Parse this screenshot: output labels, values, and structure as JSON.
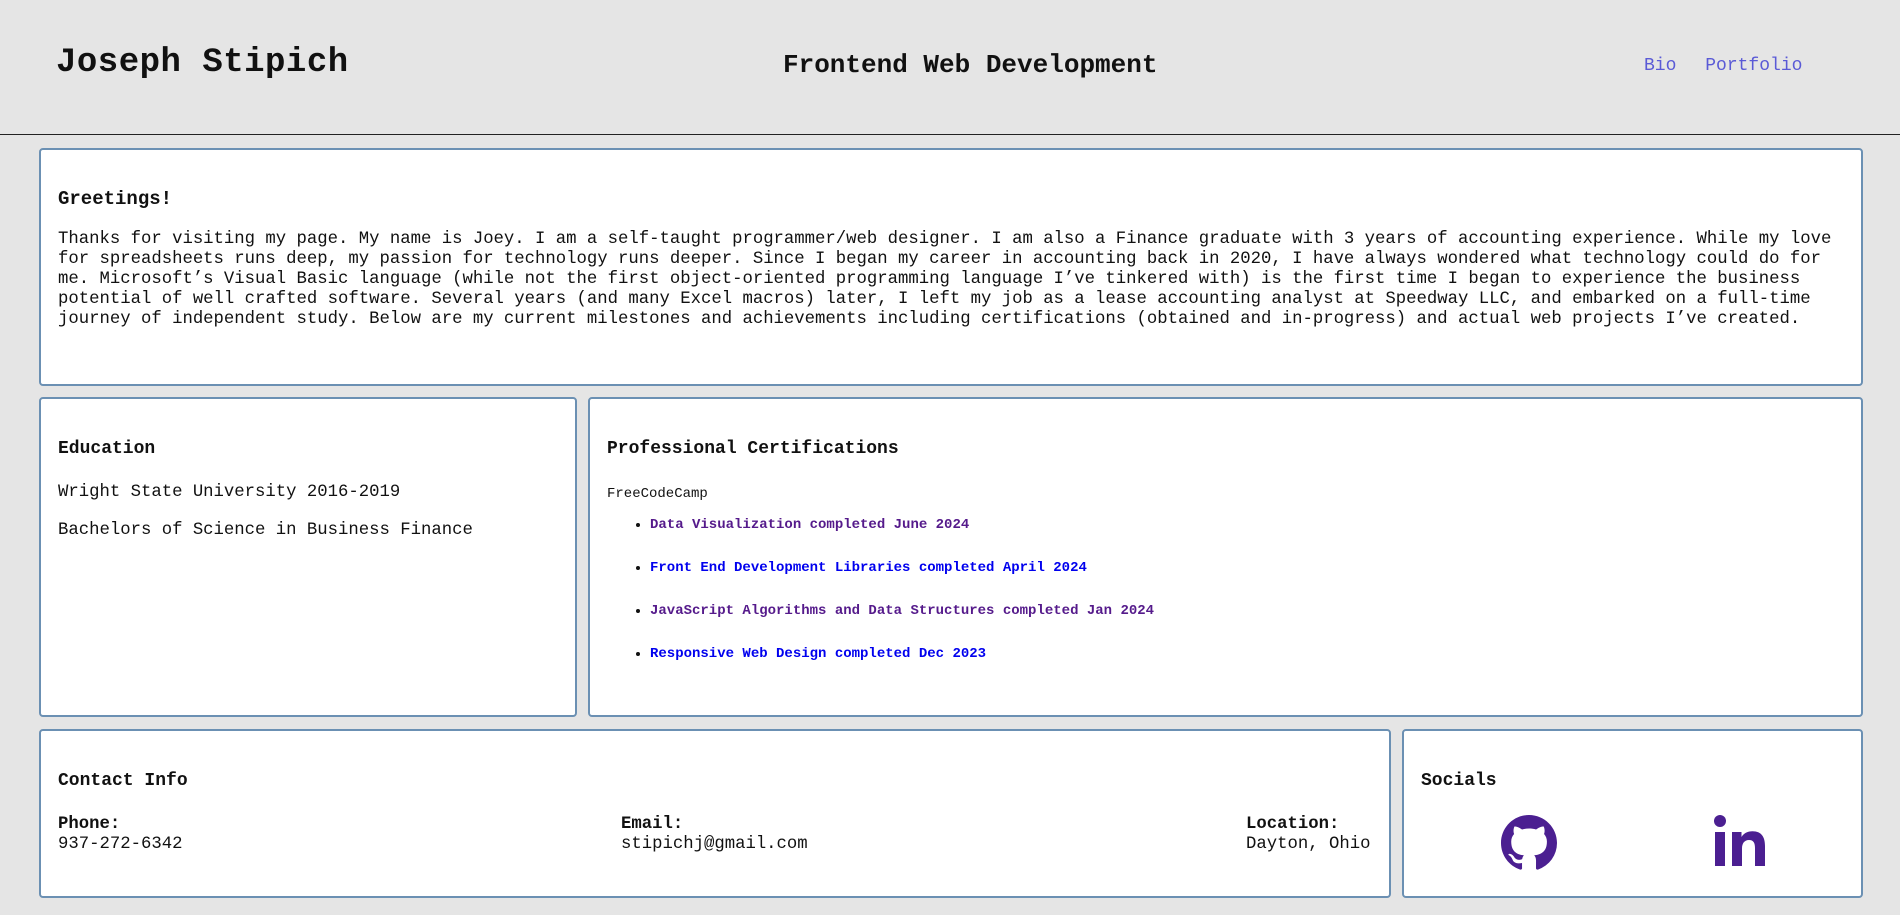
{
  "header": {
    "name": "Joseph Stipich",
    "tagline": "Frontend Web Development",
    "nav": [
      "Bio",
      "Portfolio"
    ]
  },
  "greeting": {
    "title": "Greetings!",
    "body": "Thanks for visiting my page. My name is Joey. I am a self-taught programmer/web designer. I am also a Finance graduate with 3 years of accounting experience. While my love for spreadsheets runs deep, my passion for technology runs deeper. Since I began my career in accounting back in 2020, I have always wondered what technology could do for me. Microsoft’s Visual Basic language (while not the first object-oriented programming language I’ve tinkered with) is the first time I began to experience the business potential of well crafted software. Several years (and many Excel macros) later, I left my job as a lease accounting analyst at Speedway LLC, and embarked on a full-time journey of independent study. Below are my current milestones and achievements including certifications (obtained and in-progress) and actual web projects I’ve created."
  },
  "education": {
    "title": "Education",
    "lines": [
      "Wright State University 2016-2019",
      "Bachelors of Science in Business Finance"
    ]
  },
  "certifications": {
    "title": "Professional Certifications",
    "provider": "FreeCodeCamp",
    "items": [
      {
        "label": "Data Visualization completed June 2024",
        "visited": true
      },
      {
        "label": "Front End Development Libraries completed April 2024",
        "visited": false
      },
      {
        "label": "JavaScript Algorithms and Data Structures completed Jan 2024",
        "visited": true
      },
      {
        "label": "Responsive Web Design completed Dec 2023",
        "visited": false
      }
    ]
  },
  "contact": {
    "title": "Contact Info",
    "phone_label": "Phone:",
    "phone": "937-272-6342",
    "email_label": "Email:",
    "email": "stipichj@gmail.com",
    "location_label": "Location:",
    "location": "Dayton, Ohio"
  },
  "socials": {
    "title": "Socials",
    "icons": [
      "github-icon",
      "linkedin-icon"
    ]
  },
  "colors": {
    "background": "#e5e5e5",
    "card_border": "#6b90b3",
    "nav_link": "#5a5ad6",
    "link": "#0000ee",
    "visited_link": "#551a8b",
    "social_icon": "#4b1f91"
  }
}
